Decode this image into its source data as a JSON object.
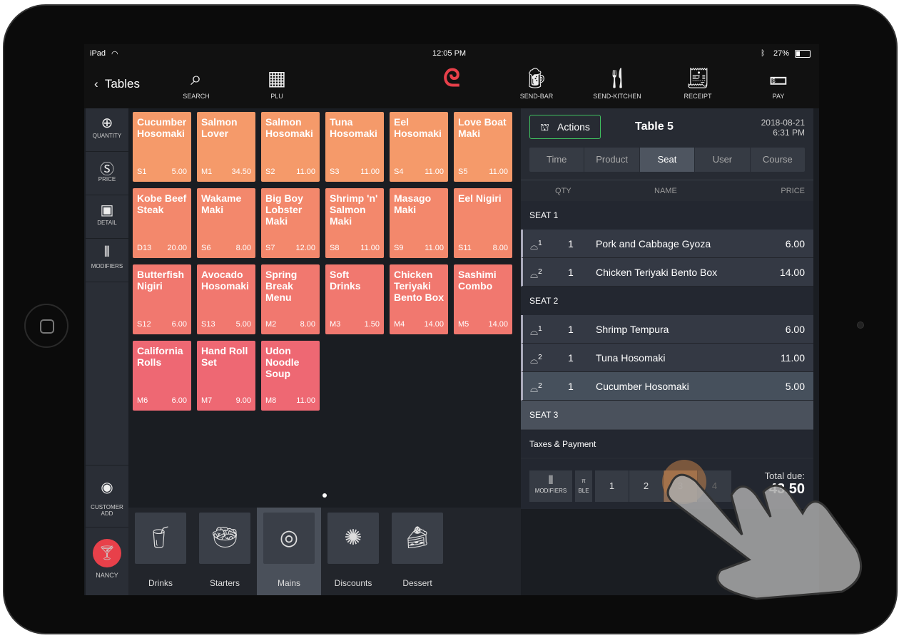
{
  "status": {
    "device": "iPad",
    "time": "12:05 PM",
    "battery": "27%"
  },
  "header": {
    "back_label": "Tables",
    "buttons": [
      {
        "label": "SEARCH",
        "icon": "search-icon"
      },
      {
        "label": "PLU",
        "icon": "grid-icon"
      },
      {
        "label": "SEND-BAR",
        "icon": "beer-mug-icon"
      },
      {
        "label": "SEND-KITCHEN",
        "icon": "fork-knife-icon"
      },
      {
        "label": "RECEIPT",
        "icon": "receipt-icon"
      },
      {
        "label": "PAY",
        "icon": "cash-icon"
      }
    ],
    "brand_color": "#e8404a"
  },
  "sidebar": {
    "items": [
      {
        "label": "QUANTITY"
      },
      {
        "label": "PRICE"
      },
      {
        "label": "DETAIL"
      },
      {
        "label": "MODIFIERS"
      }
    ],
    "customer_label": "CUSTOMER ADD",
    "user_label": "NANCY"
  },
  "products": [
    {
      "name": "Cucumber Hosomaki",
      "code": "S1",
      "price": "5.00"
    },
    {
      "name": "Salmon Lover",
      "code": "M1",
      "price": "34.50"
    },
    {
      "name": "Salmon Hosomaki",
      "code": "S2",
      "price": "11.00"
    },
    {
      "name": "Tuna Hosomaki",
      "code": "S3",
      "price": "11.00"
    },
    {
      "name": "Eel Hosomaki",
      "code": "S4",
      "price": "11.00"
    },
    {
      "name": "Love Boat Maki",
      "code": "S5",
      "price": "11.00"
    },
    {
      "name": "Kobe Beef Steak",
      "code": "D13",
      "price": "20.00"
    },
    {
      "name": "Wakame Maki",
      "code": "S6",
      "price": "8.00"
    },
    {
      "name": "Big Boy Lobster Maki",
      "code": "S7",
      "price": "12.00"
    },
    {
      "name": "Shrimp 'n' Salmon Maki",
      "code": "S8",
      "price": "11.00"
    },
    {
      "name": "Masago Maki",
      "code": "S9",
      "price": "11.00"
    },
    {
      "name": "Eel Nigiri",
      "code": "S11",
      "price": "8.00"
    },
    {
      "name": "Butterfish Nigiri",
      "code": "S12",
      "price": "6.00"
    },
    {
      "name": "Avocado Hosomaki",
      "code": "S13",
      "price": "5.00"
    },
    {
      "name": "Spring Break Menu",
      "code": "M2",
      "price": "8.00"
    },
    {
      "name": "Soft Drinks",
      "code": "M3",
      "price": "1.50"
    },
    {
      "name": "Chicken Teriyaki Bento Box",
      "code": "M4",
      "price": "14.00"
    },
    {
      "name": "Sashimi Combo",
      "code": "M5",
      "price": "14.00"
    },
    {
      "name": "California Rolls",
      "code": "M6",
      "price": "6.00"
    },
    {
      "name": "Hand Roll Set",
      "code": "M7",
      "price": "9.00"
    },
    {
      "name": "Udon Noodle Soup",
      "code": "M8",
      "price": "11.00"
    }
  ],
  "categories": [
    {
      "label": "Drinks",
      "icon": "drinks-icon"
    },
    {
      "label": "Starters",
      "icon": "salad-bowl-icon"
    },
    {
      "label": "Mains",
      "icon": "plate-icon",
      "active": true
    },
    {
      "label": "Discounts",
      "icon": "percent-badge-icon"
    },
    {
      "label": "Dessert",
      "icon": "cake-icon"
    }
  ],
  "order": {
    "actions_label": "Actions",
    "table": "Table 5",
    "date": "2018-08-21",
    "time": "6:31 PM",
    "tabs": [
      "Time",
      "Product",
      "Seat",
      "User",
      "Course"
    ],
    "active_tab": "Seat",
    "columns": [
      "QTY",
      "NAME",
      "PRICE"
    ],
    "seats": [
      {
        "label": "SEAT 1",
        "items": [
          {
            "course": "1",
            "qty": "1",
            "name": "Pork and Cabbage Gyoza",
            "price": "6.00"
          },
          {
            "course": "2",
            "qty": "1",
            "name": "Chicken Teriyaki Bento Box",
            "price": "14.00"
          }
        ]
      },
      {
        "label": "SEAT 2",
        "items": [
          {
            "course": "1",
            "qty": "1",
            "name": "Shrimp Tempura",
            "price": "6.00"
          },
          {
            "course": "2",
            "qty": "1",
            "name": "Tuna Hosomaki",
            "price": "11.00"
          },
          {
            "course": "2",
            "qty": "1",
            "name": "Cucumber Hosomaki",
            "price": "5.00",
            "selected": true
          }
        ]
      },
      {
        "label": "SEAT 3",
        "items": []
      }
    ],
    "taxes_label": "Taxes & Payment"
  },
  "footer": {
    "modifiers_label": "MODIFIERS",
    "table_label": "BLE",
    "seats": [
      "1",
      "2",
      "3",
      "4"
    ],
    "selected_seat": "3",
    "total_label": "Total due:",
    "total": "43.50"
  }
}
